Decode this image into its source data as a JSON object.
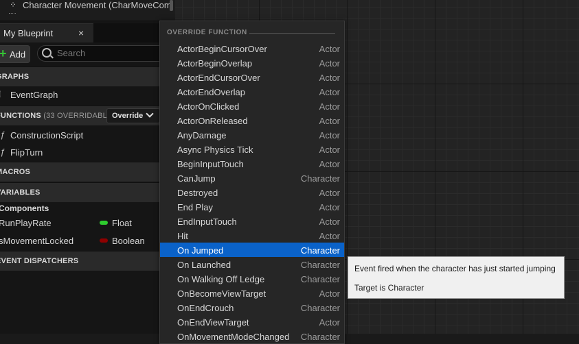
{
  "top_component": {
    "label": "Character Movement (CharMoveCom"
  },
  "tab": {
    "title": "My Blueprint",
    "close": "×"
  },
  "toolbar": {
    "add_label": "Add",
    "search_placeholder": "Search"
  },
  "sections": {
    "graphs": "GRAPHS",
    "functions": "FUNCTIONS",
    "functions_count": "(33 OVERRIDABLE)",
    "override_label": "Override",
    "macros": "MACROS",
    "variables": "VARIABLES",
    "event_dispatchers": "EVENT DISPATCHERS"
  },
  "graphs": [
    "EventGraph"
  ],
  "functions": [
    "ConstructionScript",
    "FlipTurn"
  ],
  "variables": {
    "category": "Components",
    "items": [
      {
        "name": "RunPlayRate",
        "type": "Float",
        "color": "#2ecc2e"
      },
      {
        "name": "sMovementLocked",
        "type": "Boolean",
        "color": "#8f0000"
      }
    ]
  },
  "menu": {
    "header": "OVERRIDE FUNCTION",
    "items": [
      {
        "name": "ActorBeginCursorOver",
        "cls": "Actor"
      },
      {
        "name": "ActorBeginOverlap",
        "cls": "Actor"
      },
      {
        "name": "ActorEndCursorOver",
        "cls": "Actor"
      },
      {
        "name": "ActorEndOverlap",
        "cls": "Actor"
      },
      {
        "name": "ActorOnClicked",
        "cls": "Actor"
      },
      {
        "name": "ActorOnReleased",
        "cls": "Actor"
      },
      {
        "name": "AnyDamage",
        "cls": "Actor"
      },
      {
        "name": "Async Physics Tick",
        "cls": "Actor"
      },
      {
        "name": "BeginInputTouch",
        "cls": "Actor"
      },
      {
        "name": "CanJump",
        "cls": "Character"
      },
      {
        "name": "Destroyed",
        "cls": "Actor"
      },
      {
        "name": "End Play",
        "cls": "Actor"
      },
      {
        "name": "EndInputTouch",
        "cls": "Actor"
      },
      {
        "name": "Hit",
        "cls": "Actor"
      },
      {
        "name": "On Jumped",
        "cls": "Character",
        "selected": true
      },
      {
        "name": "On Launched",
        "cls": "Character"
      },
      {
        "name": "On Walking Off Ledge",
        "cls": "Character"
      },
      {
        "name": "OnBecomeViewTarget",
        "cls": "Actor"
      },
      {
        "name": "OnEndCrouch",
        "cls": "Character"
      },
      {
        "name": "OnEndViewTarget",
        "cls": "Actor"
      },
      {
        "name": "OnMovementModeChanged",
        "cls": "Character"
      }
    ]
  },
  "tooltip": {
    "line1": "Event fired when the character has just started jumping",
    "line2": "Target is Character"
  }
}
